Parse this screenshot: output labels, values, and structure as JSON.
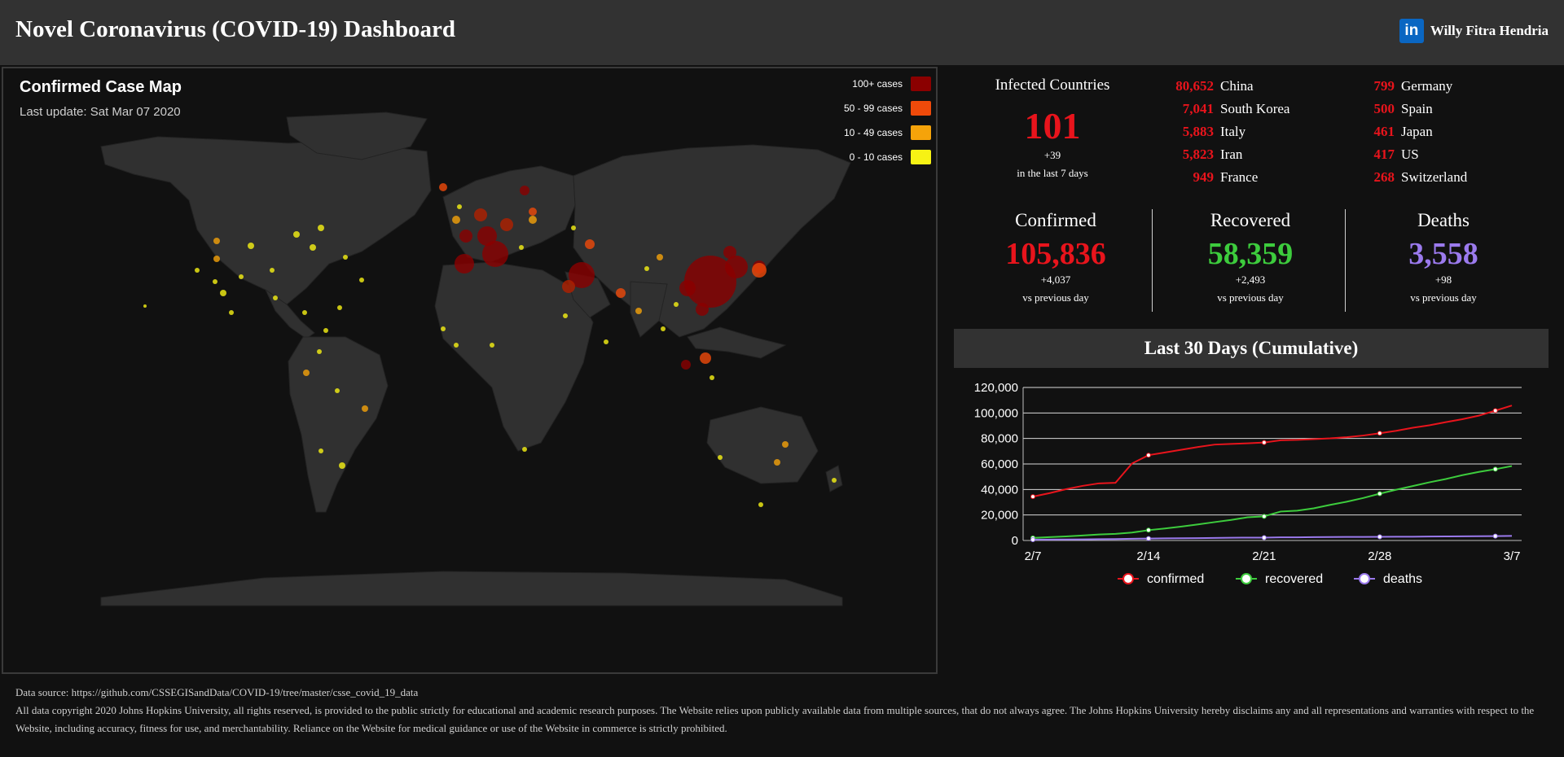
{
  "header": {
    "title": "Novel Coronavirus (COVID-19) Dashboard",
    "author": "Willy Fitra Hendria",
    "linkedin_icon": "linkedin-icon",
    "background": "#323232"
  },
  "map": {
    "title": "Confirmed Case Map",
    "last_update": "Last update: Sat Mar 07 2020",
    "legend": [
      {
        "label": "100+ cases",
        "color": "#8b0000"
      },
      {
        "label": "50 - 99 cases",
        "color": "#f04a0a"
      },
      {
        "label": "10 - 49 cases",
        "color": "#f5a30a"
      },
      {
        "label": "0 - 10 cases",
        "color": "#f7f214"
      }
    ]
  },
  "infected": {
    "label": "Infected Countries",
    "value": "101",
    "delta": "+39",
    "sub": "in the last 7 days"
  },
  "top_countries": [
    {
      "count": "80,652",
      "name": "China"
    },
    {
      "count": "7,041",
      "name": "South Korea"
    },
    {
      "count": "5,883",
      "name": "Italy"
    },
    {
      "count": "5,823",
      "name": "Iran"
    },
    {
      "count": "949",
      "name": "France"
    },
    {
      "count": "799",
      "name": "Germany"
    },
    {
      "count": "500",
      "name": "Spain"
    },
    {
      "count": "461",
      "name": "Japan"
    },
    {
      "count": "417",
      "name": "US"
    },
    {
      "count": "268",
      "name": "Switzerland"
    }
  ],
  "kpis": {
    "confirmed": {
      "label": "Confirmed",
      "value": "105,836",
      "delta": "+4,037",
      "sub": "vs previous day",
      "color": "#e8141c"
    },
    "recovered": {
      "label": "Recovered",
      "value": "58,359",
      "delta": "+2,493",
      "sub": "vs previous day",
      "color": "#3dcc3d"
    },
    "deaths": {
      "label": "Deaths",
      "value": "3,558",
      "delta": "+98",
      "sub": "vs previous day",
      "color": "#9b7aed"
    }
  },
  "trend": {
    "title": "Last 30 Days (Cumulative)"
  },
  "chart_data": {
    "type": "line",
    "title": "Last 30 Days (Cumulative)",
    "x": [
      "2/7",
      "2/8",
      "2/9",
      "2/10",
      "2/11",
      "2/12",
      "2/13",
      "2/14",
      "2/15",
      "2/16",
      "2/17",
      "2/18",
      "2/19",
      "2/20",
      "2/21",
      "2/22",
      "2/23",
      "2/24",
      "2/25",
      "2/26",
      "2/27",
      "2/28",
      "2/29",
      "3/1",
      "3/2",
      "3/3",
      "3/4",
      "3/5",
      "3/6",
      "3/7"
    ],
    "xticks": [
      "2/7",
      "2/14",
      "2/21",
      "2/28",
      "3/7"
    ],
    "ylim": [
      0,
      120000
    ],
    "yticks": [
      "0",
      "20,000",
      "40,000",
      "60,000",
      "80,000",
      "100,000",
      "120,000"
    ],
    "ytick_values": [
      0,
      20000,
      40000,
      60000,
      80000,
      100000,
      120000
    ],
    "marker_every": 7,
    "series": [
      {
        "name": "confirmed",
        "color": "#e8141c",
        "values": [
          34400,
          37100,
          40200,
          42800,
          44800,
          45200,
          60400,
          66900,
          69000,
          71200,
          73300,
          75200,
          75700,
          76200,
          76800,
          78600,
          78900,
          79500,
          80100,
          81000,
          82300,
          84100,
          86000,
          88400,
          90300,
          92800,
          95100,
          97900,
          101800,
          105836
        ]
      },
      {
        "name": "recovered",
        "color": "#3dcc3d",
        "values": [
          2000,
          2600,
          3200,
          3900,
          4700,
          5200,
          6200,
          8100,
          9400,
          10900,
          12600,
          14400,
          16100,
          18200,
          18900,
          22700,
          23400,
          25200,
          27900,
          30400,
          33300,
          36700,
          39800,
          42700,
          45600,
          48200,
          51200,
          53800,
          55900,
          58359
        ]
      },
      {
        "name": "deaths",
        "color": "#9b7aed",
        "values": [
          640,
          720,
          810,
          910,
          1010,
          1110,
          1370,
          1520,
          1660,
          1770,
          1870,
          2010,
          2120,
          2250,
          2250,
          2460,
          2470,
          2630,
          2710,
          2770,
          2810,
          2860,
          2940,
          2990,
          3090,
          3160,
          3260,
          3350,
          3460,
          3558
        ]
      }
    ]
  },
  "footer": {
    "source": "Data source: https://github.com/CSSEGISandData/COVID-19/tree/master/csse_covid_19_data",
    "copyright": "All data copyright 2020 Johns Hopkins University, all rights reserved, is provided to the public strictly for educational and academic research purposes. The Website relies upon publicly available data from multiple sources, that do not always agree. The Johns Hopkins University hereby disclaims any and all representations and warranties with respect to the Website, including accuracy, fitness for use, and merchantability. Reliance on the Website for medical guidance or use of the Website in commerce is strictly prohibited."
  }
}
